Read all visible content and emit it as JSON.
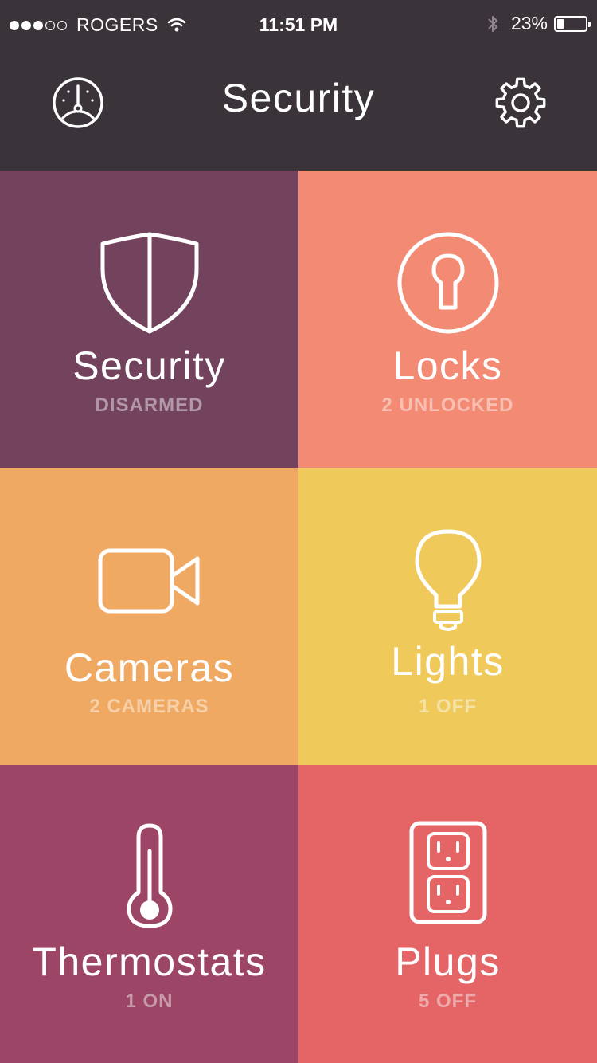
{
  "status_bar": {
    "carrier": "ROGERS",
    "time": "11:51 PM",
    "battery": "23%",
    "battery_level": 0.23,
    "signal_bars_filled": 3,
    "signal_bars_total": 5
  },
  "nav": {
    "title": "Security",
    "left_icon": "dashboard-dial-icon",
    "right_icon": "gear-icon"
  },
  "colors": {
    "header_bg": "#3b333a",
    "security": "#73435e",
    "locks": "#f38a73",
    "cameras": "#f0a962",
    "lights": "#efc95a",
    "thermostats": "#9c4566",
    "plugs": "#e56567"
  },
  "tiles": [
    {
      "label": "Security",
      "status": "DISARMED",
      "icon": "shield-icon"
    },
    {
      "label": "Locks",
      "status": "2 UNLOCKED",
      "icon": "keyhole-icon"
    },
    {
      "label": "Cameras",
      "status": "2 CAMERAS",
      "icon": "video-camera-icon"
    },
    {
      "label": "Lights",
      "status": "1 OFF",
      "icon": "light-bulb-icon"
    },
    {
      "label": "Thermostats",
      "status": "1 ON",
      "icon": "thermometer-icon"
    },
    {
      "label": "Plugs",
      "status": "5 OFF",
      "icon": "outlet-icon"
    }
  ]
}
